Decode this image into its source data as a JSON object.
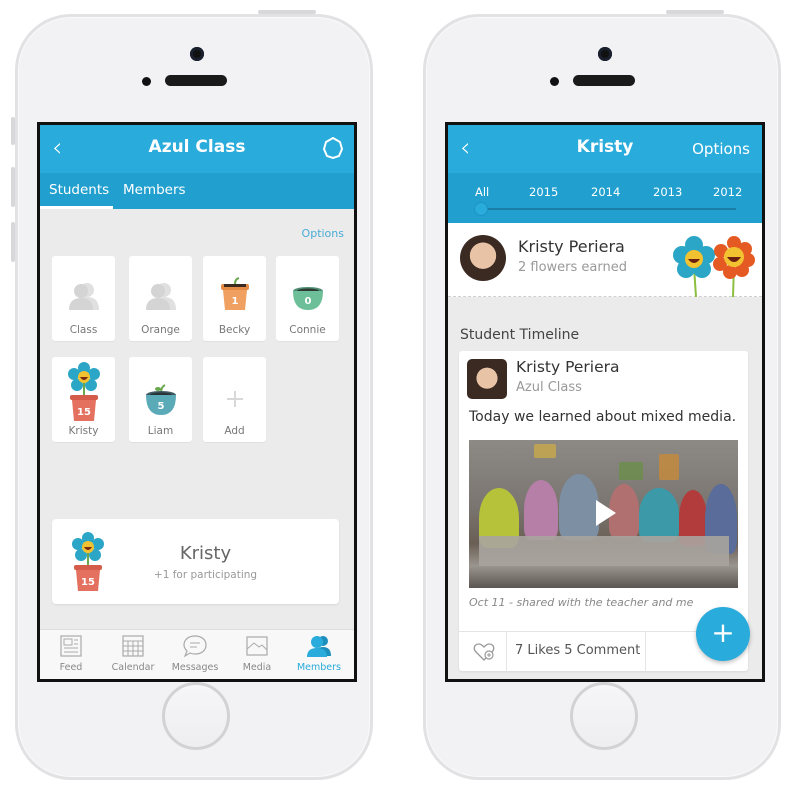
{
  "left_phone": {
    "header": {
      "back_icon": "chevron-left",
      "title": "Azul Class",
      "settings_icon": "gear-icon"
    },
    "tabs": [
      {
        "label": "Students",
        "active": true
      },
      {
        "label": "Members",
        "active": false
      }
    ],
    "options_label": "Options",
    "tiles": [
      {
        "label": "Class",
        "icon": "group-icon"
      },
      {
        "label": "Orange",
        "icon": "group-icon"
      },
      {
        "label": "Becky",
        "icon": "pot-icon",
        "count": "1",
        "pot_color": "#f0a060"
      },
      {
        "label": "Connie",
        "icon": "pot-icon",
        "count": "0",
        "pot_color": "#6cbf98"
      },
      {
        "label": "Kristy",
        "icon": "flower-pot-icon",
        "count": "15",
        "pot_color": "#e4715f"
      },
      {
        "label": "Liam",
        "icon": "sprout-pot-icon",
        "count": "5",
        "pot_color": "#5aaab8"
      },
      {
        "label": "Add",
        "icon": "plus-icon"
      }
    ],
    "notification": {
      "name": "Kristy",
      "message": "+1 for participating",
      "count": "15"
    },
    "tabbar": [
      {
        "label": "Feed",
        "icon": "feed-icon",
        "active": false
      },
      {
        "label": "Calendar",
        "icon": "calendar-icon",
        "active": false
      },
      {
        "label": "Messages",
        "icon": "messages-icon",
        "active": false
      },
      {
        "label": "Media",
        "icon": "media-icon",
        "active": false
      },
      {
        "label": "Members",
        "icon": "members-icon",
        "active": true
      }
    ]
  },
  "right_phone": {
    "header": {
      "back_icon": "chevron-left",
      "title": "Kristy",
      "options_label": "Options"
    },
    "years": [
      "All",
      "2015",
      "2014",
      "2013",
      "2012"
    ],
    "selected_year": "All",
    "profile": {
      "name": "Kristy Periera",
      "subtitle": "2 flowers earned"
    },
    "timeline_heading": "Student Timeline",
    "post": {
      "author": "Kristy Periera",
      "class": "Azul Class",
      "text": "Today we learned about mixed media.",
      "date": "Oct 11 - shared with the teacher and me",
      "likes_comments": "7 Likes  5 Comment"
    },
    "fab_label": "+"
  },
  "colors": {
    "accent": "#29abdb",
    "accent_dark": "#21a0cf",
    "background": "#ebebeb"
  }
}
